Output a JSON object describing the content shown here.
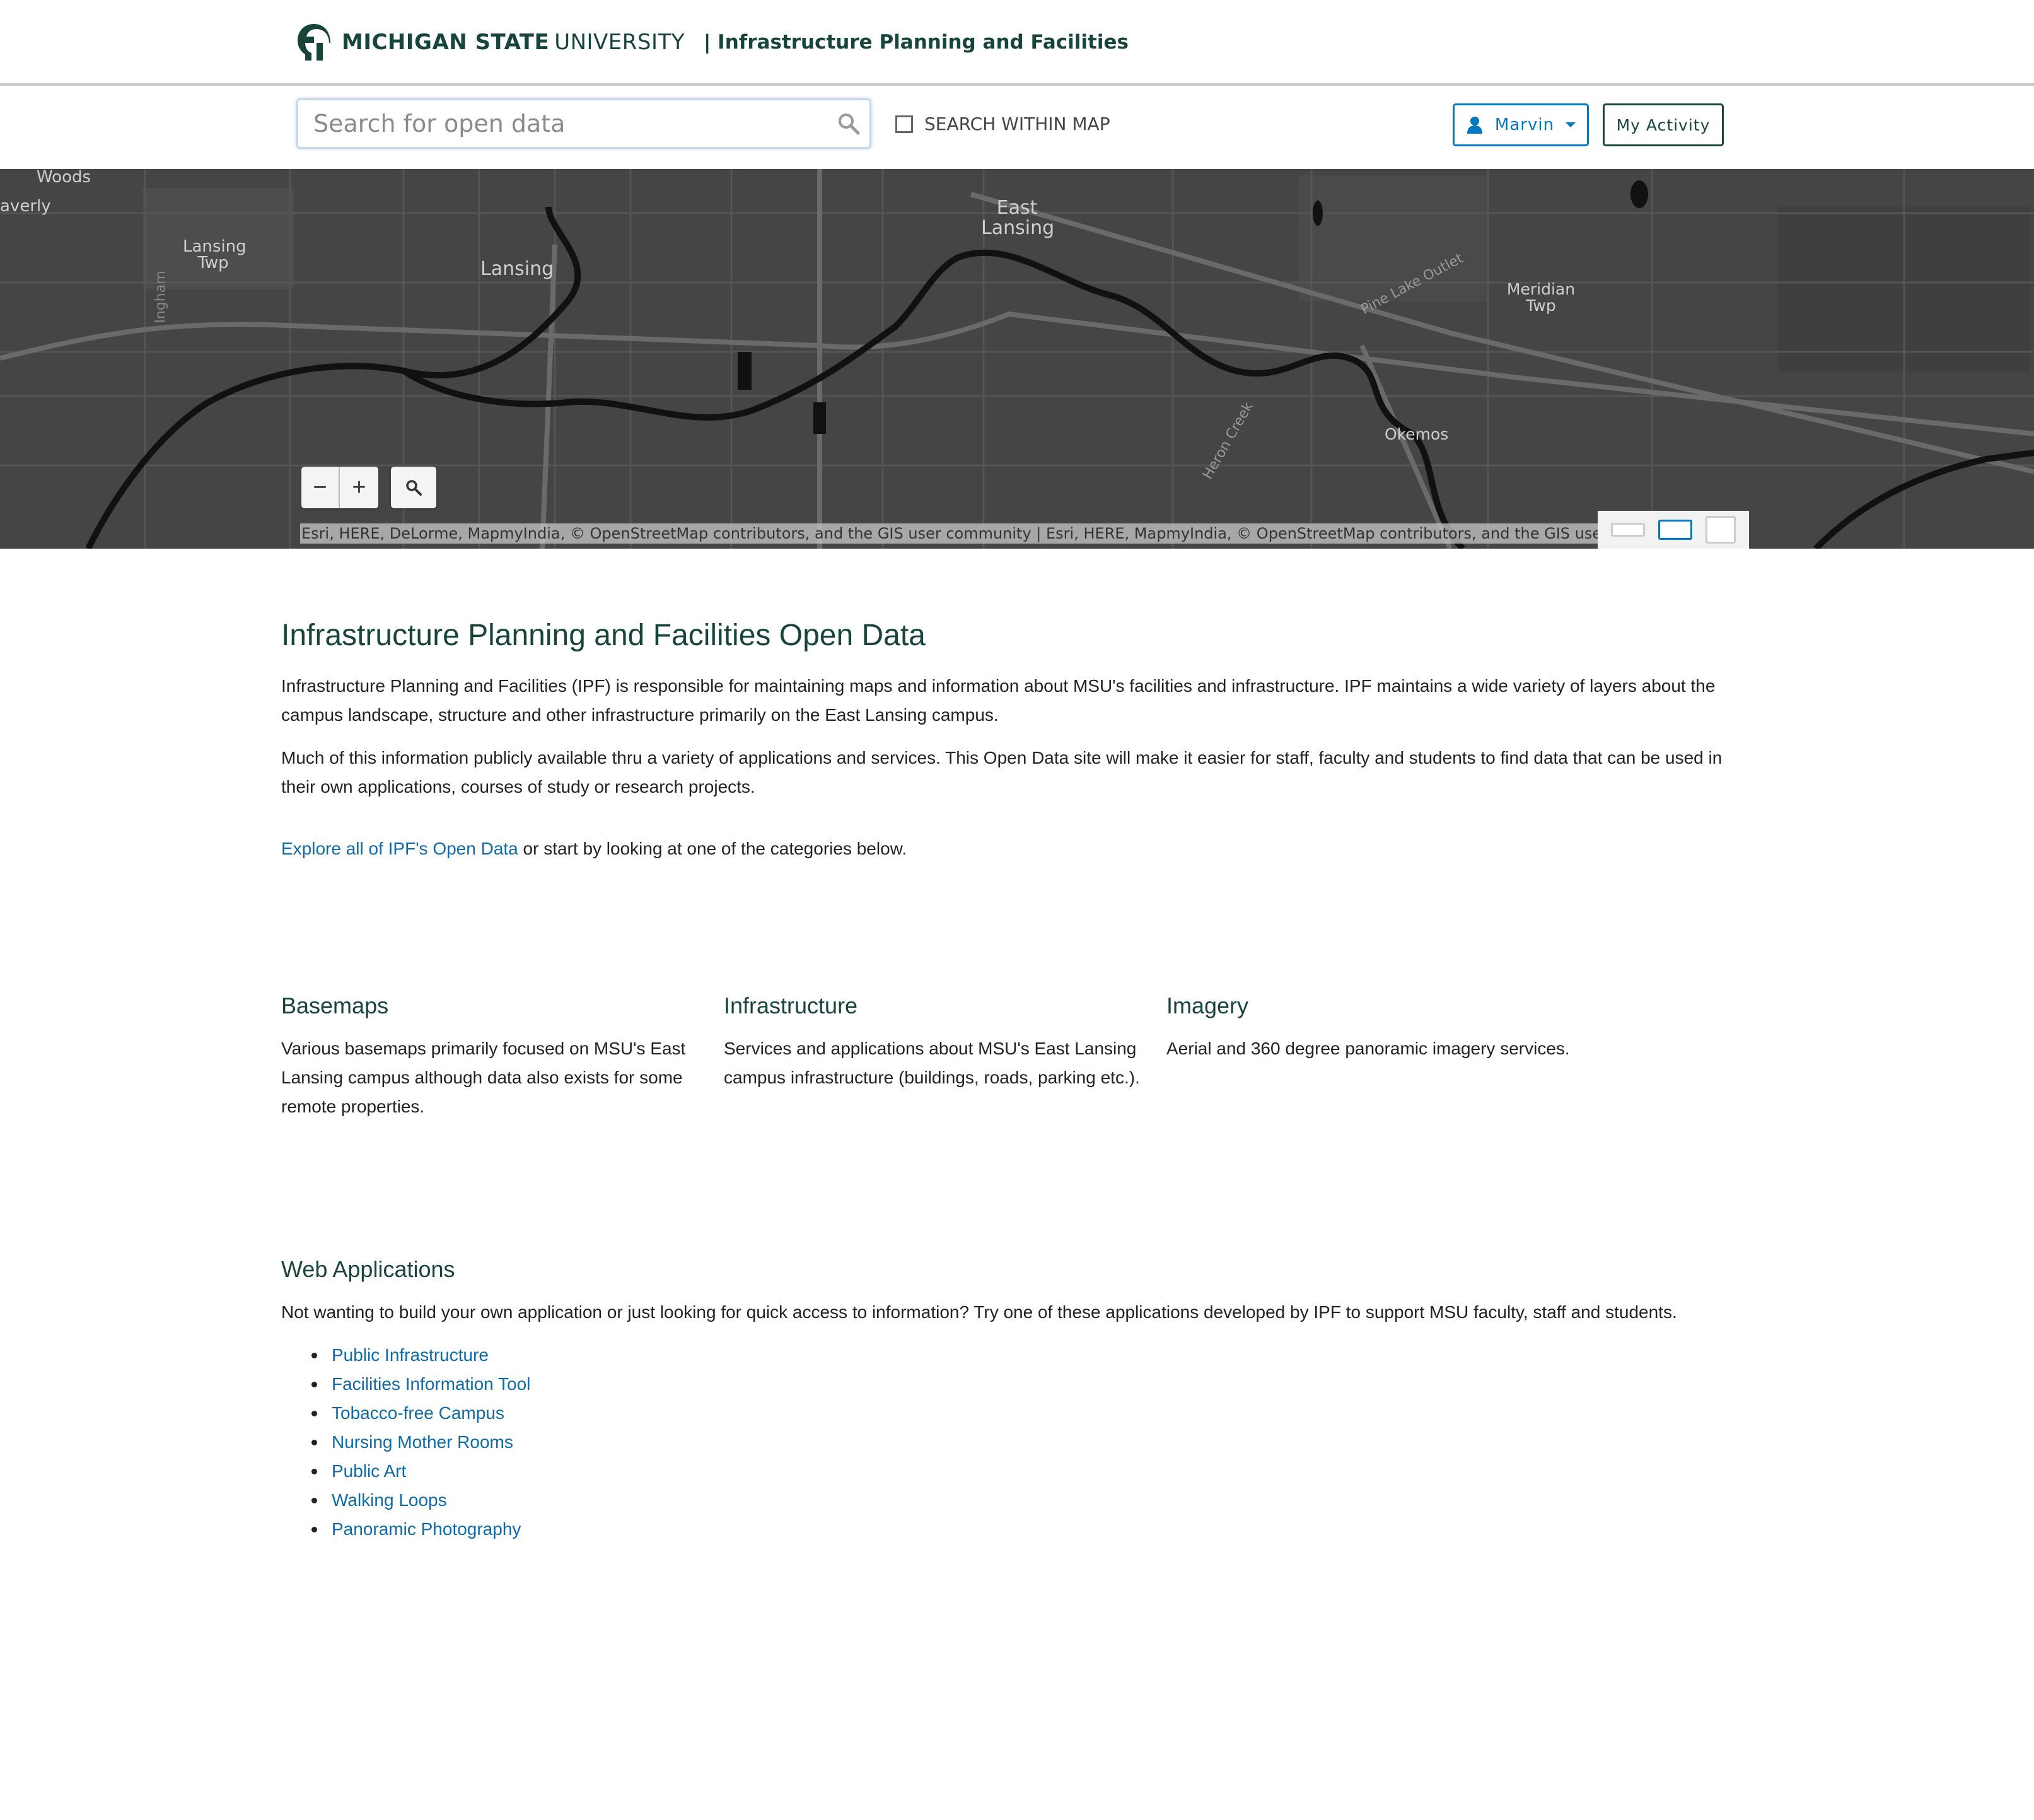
{
  "header": {
    "brand_strong": "MICHIGAN STATE",
    "brand_light": "UNIVERSITY",
    "site_title": "| Infrastructure Planning and Facilities"
  },
  "toolbar": {
    "search_placeholder": "Search for open data",
    "search_within_map_label": "SEARCH WITHIN MAP",
    "user_label": "Marvin",
    "activity_label": "My Activity"
  },
  "map": {
    "labels": {
      "woods": "Woods",
      "waverly": "averly",
      "lansing_twp": "Lansing Twp",
      "ingham": "Ingham",
      "lansing": "Lansing",
      "east_lansing": "East Lansing",
      "pine_lake_outlet": "Pine Lake Outlet",
      "meridian_twp": "Meridian Twp",
      "okemos": "Okemos",
      "heron_creek": "Heron Creek"
    },
    "zoom_out": "−",
    "zoom_in": "+",
    "attribution": "Esri, HERE, DeLorme, MapmyIndia, © OpenStreetMap contributors, and the GIS user community |  Esri, HERE, MapmyIndia, © OpenStreetMap contributors, and the GIS user co"
  },
  "intro": {
    "title": "Infrastructure Planning and Facilities Open Data",
    "para1": "Infrastructure Planning and Facilities (IPF) is responsible for maintaining maps and information about MSU's facilities and infrastructure. IPF maintains a wide variety of layers about the campus landscape, structure and other infrastructure primarily on the East Lansing campus.",
    "para2": "Much of this information publicly available thru a variety of applications and services. This Open Data site will make it easier for staff, faculty and students to find data that can be used in their own applications, courses of study or research projects.",
    "explore_link": "Explore all of IPF's Open Data",
    "explore_rest": " or start by looking at one of the categories below."
  },
  "categories": [
    {
      "title": "Basemaps",
      "description": "Various basemaps primarily focused on MSU's East Lansing campus although data also exists for some remote properties."
    },
    {
      "title": "Infrastructure",
      "description": "Services and applications about MSU's East Lansing campus infrastructure (buildings, roads, parking etc.)."
    },
    {
      "title": "Imagery",
      "description": "Aerial and 360 degree panoramic imagery services."
    }
  ],
  "webapps": {
    "title": "Web Applications",
    "description": "Not wanting to build your own application or just looking for quick access to information? Try one of these applications developed by IPF to support MSU faculty, staff and students.",
    "links": [
      "Public Infrastructure",
      "Facilities Information Tool",
      "Tobacco-free Campus",
      "Nursing Mother Rooms",
      "Public Art",
      "Walking Loops",
      "Panoramic Photography"
    ]
  },
  "colors": {
    "msu_green": "#18453b",
    "link_blue": "#0c6ba8",
    "button_blue": "#0079c1",
    "map_bg": "#454545"
  }
}
